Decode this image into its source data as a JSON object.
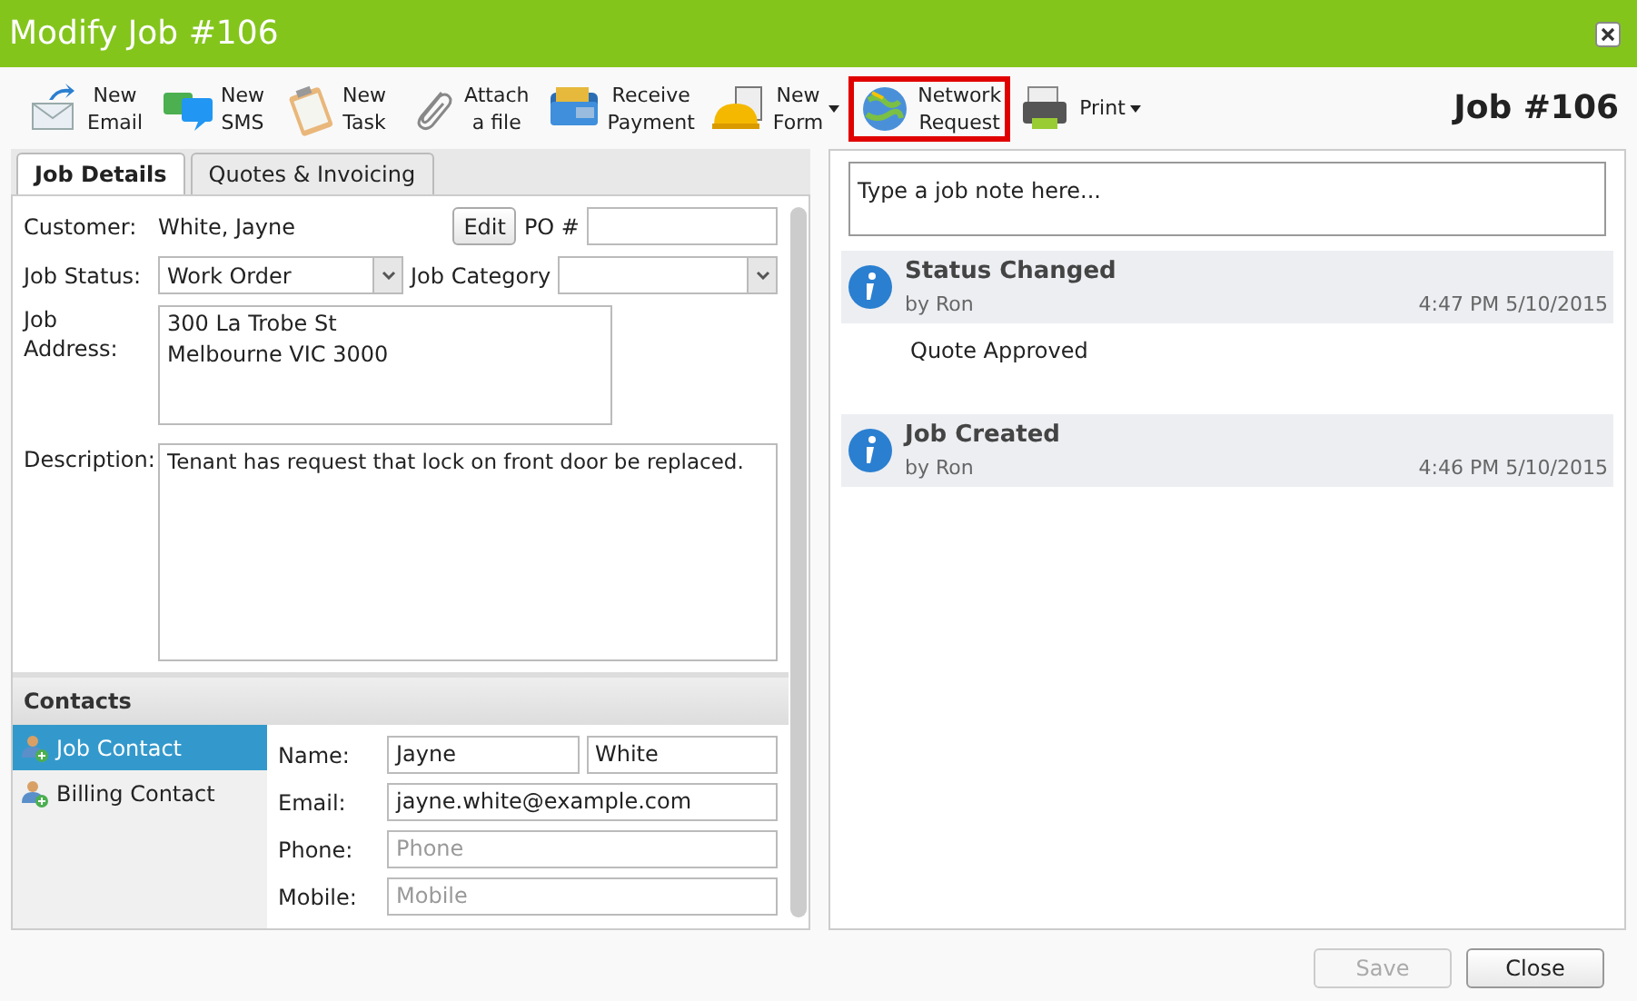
{
  "window": {
    "title": "Modify Job #106"
  },
  "toolbar": [
    {
      "kind": "email",
      "label": "New\nEmail",
      "has_menu": false,
      "highlighted": false
    },
    {
      "kind": "sms",
      "label": "New\nSMS",
      "has_menu": false,
      "highlighted": false
    },
    {
      "kind": "task",
      "label": "New\nTask",
      "has_menu": false,
      "highlighted": false
    },
    {
      "kind": "attach",
      "label": "Attach\na file",
      "has_menu": false,
      "highlighted": false
    },
    {
      "kind": "payment",
      "label": "Receive\nPayment",
      "has_menu": false,
      "highlighted": false
    },
    {
      "kind": "form",
      "label": "New\nForm",
      "has_menu": true,
      "highlighted": false
    },
    {
      "kind": "network",
      "label": "Network\nRequest",
      "has_menu": false,
      "highlighted": true
    },
    {
      "kind": "print",
      "label": "Print",
      "has_menu": true,
      "highlighted": false
    }
  ],
  "job_heading": "Job #106",
  "tabs": [
    {
      "label": "Job Details",
      "selected": true
    },
    {
      "label": "Quotes & Invoicing",
      "selected": false
    }
  ],
  "details": {
    "customer_label": "Customer:",
    "customer": "White, Jayne",
    "edit_button": "Edit",
    "po_label": "PO #",
    "status_label": "Job Status:",
    "status": "Work Order",
    "category_label": "Job Category",
    "address_label": "Job Address:",
    "address": "300 La Trobe St\nMelbourne VIC 3000",
    "description_label": "Description:",
    "description": "Tenant has request that lock on front door be replaced."
  },
  "contacts": {
    "title": "Contacts",
    "items": [
      {
        "label": "Job Contact",
        "selected": true
      },
      {
        "label": "Billing Contact",
        "selected": false
      }
    ],
    "fields": [
      {
        "label": "Name:",
        "values": [
          "Jayne",
          "White"
        ]
      },
      {
        "label": "Email:",
        "values": [
          "jayne.white@example.com"
        ]
      },
      {
        "label": "Phone:",
        "placeholder": "Phone"
      },
      {
        "label": "Mobile:",
        "placeholder": "Mobile"
      }
    ]
  },
  "note": {
    "placeholder": "Type a job note here..."
  },
  "activity": [
    {
      "title": "Status Changed",
      "by": "by Ron",
      "time": "4:47 PM 5/10/2015",
      "body": "Quote Approved"
    },
    {
      "title": "Job Created",
      "by": "by Ron",
      "time": "4:46 PM 5/10/2015"
    }
  ],
  "buttons": [
    {
      "label": "Save",
      "disabled": true
    },
    {
      "label": "Close",
      "disabled": false
    }
  ]
}
